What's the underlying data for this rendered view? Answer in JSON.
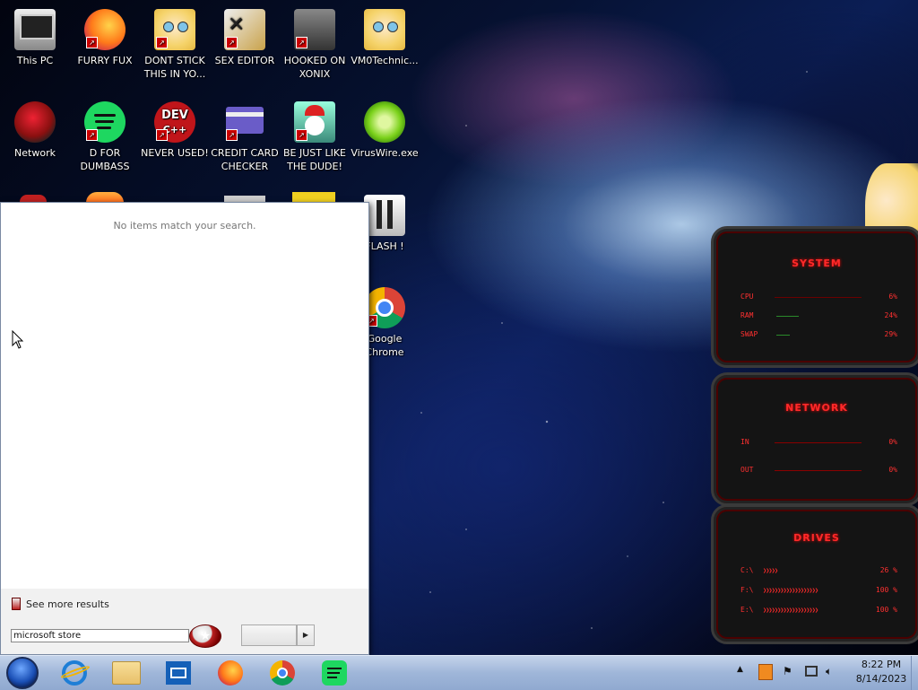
{
  "desktop": {
    "icons": [
      {
        "label": "This PC",
        "icon": "computer-icon",
        "color": "#444444"
      },
      {
        "label": "FURRY FUX",
        "icon": "firefox-icon",
        "color": "#ff7a1a"
      },
      {
        "label": "DONT STICK THIS IN YO...",
        "icon": "cartoon-character-icon",
        "color": "#f5d36a"
      },
      {
        "label": "SEX EDITOR",
        "icon": "hxd-icon",
        "color": "#c9a24a"
      },
      {
        "label": "HOOKED ON XONIX",
        "icon": "game-icon",
        "color": "#555555"
      },
      {
        "label": "VM0Technic...",
        "icon": "cartoon-character-icon",
        "color": "#f5d36a"
      },
      {
        "label": "Network",
        "icon": "network-icon",
        "color": "#8a1010"
      },
      {
        "label": "D FOR DUMBASS",
        "icon": "spotify-icon",
        "color": "#1ed760"
      },
      {
        "label": "NEVER USED!",
        "icon": "devcpp-icon",
        "color": "#c0151a"
      },
      {
        "label": "CREDIT CARD CHECKER",
        "icon": "credit-card-icon",
        "color": "#6a5cc8"
      },
      {
        "label": "BE JUST LIKE THE DUDE!",
        "icon": "santa-icon",
        "color": "#3a8a7a"
      },
      {
        "label": "VirusWire.exe",
        "icon": "limewire-icon",
        "color": "#7ad11a"
      },
      {
        "label": "FLASH !",
        "icon": "flash-icon",
        "color": "#dddddd"
      },
      {
        "label": "Google Chrome",
        "icon": "chrome-icon",
        "color": "#db4437"
      }
    ]
  },
  "start_menu": {
    "no_items_text": "No items match your search.",
    "see_more_label": "See more results",
    "search_value": "microsoft store"
  },
  "gadget": {
    "system": {
      "title": "SYSTEM",
      "rows": [
        {
          "label": "CPU",
          "value": "6%"
        },
        {
          "label": "RAM",
          "value": "24%"
        },
        {
          "label": "SWAP",
          "value": "29%"
        }
      ]
    },
    "network": {
      "title": "NETWORK",
      "rows": [
        {
          "label": "IN",
          "value": "0%"
        },
        {
          "label": "OUT",
          "value": "0%"
        }
      ]
    },
    "drives": {
      "title": "DRIVES",
      "rows": [
        {
          "label": "C:\\",
          "value": "26 %"
        },
        {
          "label": "F:\\",
          "value": "100 %"
        },
        {
          "label": "E:\\",
          "value": "100 %"
        }
      ]
    }
  },
  "taskbar": {
    "pinned": [
      {
        "name": "internet-explorer",
        "icon": "ie-icon",
        "color": "#1e7ed6"
      },
      {
        "name": "file-explorer",
        "icon": "folder-icon",
        "color": "#e8c06a"
      },
      {
        "name": "mail",
        "icon": "mail-icon",
        "color": "#1560b8"
      },
      {
        "name": "firefox",
        "icon": "firefox-icon",
        "color": "#ff7a1a"
      },
      {
        "name": "chrome",
        "icon": "chrome-icon",
        "color": "#db4437"
      },
      {
        "name": "spotify",
        "icon": "spotify-icon",
        "color": "#1ed760"
      }
    ],
    "clock_time": "8:22 PM",
    "clock_date": "8/14/2023"
  }
}
